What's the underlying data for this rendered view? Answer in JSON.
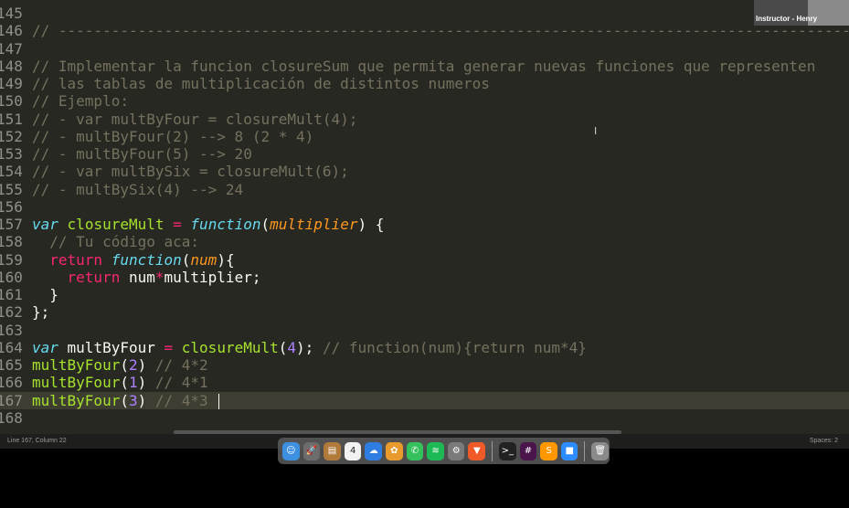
{
  "editor": {
    "lines": [
      {
        "num": "145",
        "parts": []
      },
      {
        "num": "146",
        "parts": [
          {
            "t": "// ---------------------------------------------------------------------------------------------------------",
            "c": "c"
          }
        ]
      },
      {
        "num": "147",
        "parts": []
      },
      {
        "num": "148",
        "parts": [
          {
            "t": "// Implementar la funcion closureSum que permita generar nuevas funciones que representen",
            "c": "c"
          }
        ]
      },
      {
        "num": "149",
        "parts": [
          {
            "t": "// las tablas de multiplicación de distintos numeros",
            "c": "c"
          }
        ]
      },
      {
        "num": "150",
        "parts": [
          {
            "t": "// Ejemplo:",
            "c": "c"
          }
        ]
      },
      {
        "num": "151",
        "parts": [
          {
            "t": "// - var multByFour = closureMult(4);",
            "c": "c"
          }
        ]
      },
      {
        "num": "152",
        "parts": [
          {
            "t": "// - multByFour(2) --> 8 (2 * 4)",
            "c": "c"
          }
        ]
      },
      {
        "num": "153",
        "parts": [
          {
            "t": "// - multByFour(5) --> 20",
            "c": "c"
          }
        ]
      },
      {
        "num": "154",
        "parts": [
          {
            "t": "// - var multBySix = closureMult(6);",
            "c": "c"
          }
        ]
      },
      {
        "num": "155",
        "parts": [
          {
            "t": "// - multBySix(4) --> 24",
            "c": "c"
          }
        ]
      },
      {
        "num": "156",
        "parts": []
      },
      {
        "num": "157",
        "parts": [
          {
            "t": "var",
            "c": "st"
          },
          {
            "t": " ",
            "c": ""
          },
          {
            "t": "closureMult",
            "c": "fn"
          },
          {
            "t": " = ",
            "c": "kw"
          },
          {
            "t": "function",
            "c": "st"
          },
          {
            "t": "(",
            "c": ""
          },
          {
            "t": "multiplier",
            "c": "pa"
          },
          {
            "t": ") {",
            "c": ""
          }
        ]
      },
      {
        "num": "158",
        "parts": [
          {
            "t": "  // Tu código aca:",
            "c": "c"
          }
        ]
      },
      {
        "num": "159",
        "parts": [
          {
            "t": "  ",
            "c": ""
          },
          {
            "t": "return",
            "c": "kw"
          },
          {
            "t": " ",
            "c": ""
          },
          {
            "t": "function",
            "c": "st"
          },
          {
            "t": "(",
            "c": ""
          },
          {
            "t": "num",
            "c": "pa"
          },
          {
            "t": "){",
            "c": ""
          }
        ]
      },
      {
        "num": "160",
        "parts": [
          {
            "t": "    ",
            "c": ""
          },
          {
            "t": "return",
            "c": "kw"
          },
          {
            "t": " num",
            "c": ""
          },
          {
            "t": "*",
            "c": "kw"
          },
          {
            "t": "multiplier;",
            "c": ""
          }
        ]
      },
      {
        "num": "161",
        "parts": [
          {
            "t": "  }",
            "c": ""
          }
        ]
      },
      {
        "num": "162",
        "parts": [
          {
            "t": "};",
            "c": ""
          }
        ]
      },
      {
        "num": "163",
        "parts": []
      },
      {
        "num": "164",
        "parts": [
          {
            "t": "var",
            "c": "st"
          },
          {
            "t": " multByFour ",
            "c": ""
          },
          {
            "t": "=",
            "c": "kw"
          },
          {
            "t": " ",
            "c": ""
          },
          {
            "t": "closureMult",
            "c": "fn"
          },
          {
            "t": "(",
            "c": ""
          },
          {
            "t": "4",
            "c": "nu"
          },
          {
            "t": "); ",
            "c": ""
          },
          {
            "t": "// function(num){return num*4}",
            "c": "c"
          }
        ]
      },
      {
        "num": "165",
        "parts": [
          {
            "t": "multByFour",
            "c": "fn"
          },
          {
            "t": "(",
            "c": ""
          },
          {
            "t": "2",
            "c": "nu"
          },
          {
            "t": ") ",
            "c": ""
          },
          {
            "t": "// 4*2",
            "c": "c"
          }
        ]
      },
      {
        "num": "166",
        "parts": [
          {
            "t": "multByFour",
            "c": "fn"
          },
          {
            "t": "(",
            "c": ""
          },
          {
            "t": "1",
            "c": "nu"
          },
          {
            "t": ") ",
            "c": ""
          },
          {
            "t": "// 4*1",
            "c": "c"
          }
        ]
      },
      {
        "num": "167",
        "parts": [
          {
            "t": "multByFour",
            "c": "fn"
          },
          {
            "t": "(",
            "c": ""
          },
          {
            "t": "3",
            "c": "nu"
          },
          {
            "t": ") ",
            "c": ""
          },
          {
            "t": "// 4*3 ",
            "c": "c"
          }
        ],
        "current": true
      },
      {
        "num": "168",
        "parts": []
      }
    ]
  },
  "status_bar": {
    "position": "Line 167, Column 22",
    "spaces": "Spaces: 2"
  },
  "webcam": {
    "label": "Instructor - Henry"
  },
  "dock": {
    "apps": [
      {
        "name": "finder-icon",
        "glyph": "☺",
        "color": "#3d8fe0"
      },
      {
        "name": "launchpad-icon",
        "glyph": "🚀",
        "color": "#6c6c6c"
      },
      {
        "name": "notes-icon",
        "glyph": "▤",
        "color": "#b07a3a"
      },
      {
        "name": "calendar-icon",
        "glyph": "4",
        "color": "#f2f2f2"
      },
      {
        "name": "messages-icon",
        "glyph": "☁",
        "color": "#2f7de0"
      },
      {
        "name": "photos-icon",
        "glyph": "✿",
        "color": "#e89b2c"
      },
      {
        "name": "whatsapp-icon",
        "glyph": "✆",
        "color": "#34c05a"
      },
      {
        "name": "spotify-icon",
        "glyph": "≋",
        "color": "#1db954"
      },
      {
        "name": "settings-icon",
        "glyph": "⚙",
        "color": "#7a7a7a"
      },
      {
        "name": "brave-icon",
        "glyph": "▼",
        "color": "#f05a28"
      },
      {
        "name": "terminal-icon",
        "glyph": ">_",
        "color": "#222"
      },
      {
        "name": "slack-icon",
        "glyph": "#",
        "color": "#4a154b"
      },
      {
        "name": "sublime-icon",
        "glyph": "S",
        "color": "#ff9800"
      },
      {
        "name": "zoom-icon",
        "glyph": "■",
        "color": "#2d8cff"
      },
      {
        "name": "trash-icon",
        "glyph": "🗑",
        "color": "#8a8a8a"
      }
    ]
  }
}
